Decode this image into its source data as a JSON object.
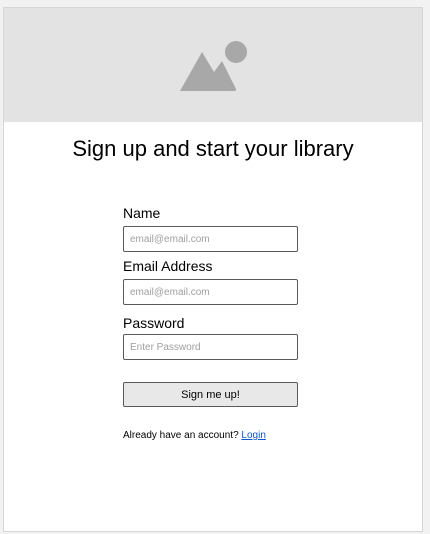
{
  "hero": {
    "icon": "image-placeholder-icon",
    "background_color": "#e3e3e3",
    "icon_color": "#a8a8a8"
  },
  "page": {
    "title": "Sign up and start your library"
  },
  "form": {
    "name_label": "Name",
    "name_placeholder": "email@email.com",
    "email_label": "Email Address",
    "email_placeholder": "email@email.com",
    "password_label": "Password",
    "password_placeholder": "Enter Password",
    "submit_label": "Sign me up!"
  },
  "footer": {
    "prompt": "Already have an account?",
    "login_link": "Login",
    "link_color": "#0a58ca"
  }
}
